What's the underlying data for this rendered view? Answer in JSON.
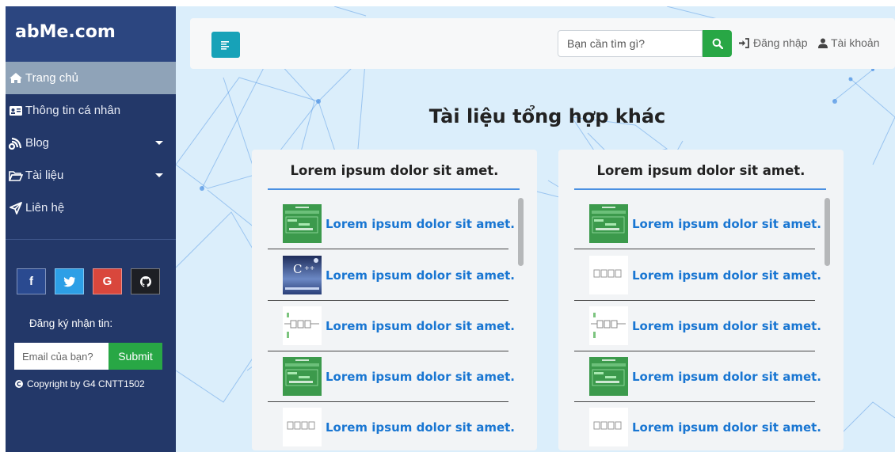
{
  "sidebar": {
    "brand": "abMe.com",
    "items": [
      {
        "label": "Trang chủ",
        "icon": "home-icon"
      },
      {
        "label": "Thông tin cá nhân",
        "icon": "id-card-icon"
      },
      {
        "label": "Blog",
        "icon": "blog-icon"
      },
      {
        "label": "Tài liệu",
        "icon": "folder-open-icon"
      },
      {
        "label": "Liên hệ",
        "icon": "paper-plane-icon"
      }
    ],
    "socials": [
      "f",
      "facebook-icon",
      "twitter-icon",
      "G",
      "github-icon"
    ],
    "google_letter": "G",
    "facebook_letter": "f",
    "newsletter_label": "Đăng ký nhận tin:",
    "email_placeholder": "Email của bạn?",
    "submit_label": "Submit",
    "copyright": "Copyright by G4 CNTT1502"
  },
  "topbar": {
    "search_placeholder": "Bạn cần tìm gì?",
    "login_label": "Đăng nhập",
    "account_label": "Tài khoản"
  },
  "main": {
    "heading": "Tài liệu tổng hợp khác",
    "cards": [
      {
        "title": "Lorem ipsum dolor sit amet.",
        "items": [
          {
            "text": "Lorem ipsum dolor sit amet.",
            "thumb": "green"
          },
          {
            "text": "Lorem ipsum dolor sit amet.",
            "thumb": "cpp"
          },
          {
            "text": "Lorem ipsum dolor sit amet.",
            "thumb": "diagram"
          },
          {
            "text": "Lorem ipsum dolor sit amet.",
            "thumb": "green"
          },
          {
            "text": "Lorem ipsum dolor sit amet.",
            "thumb": "diagram"
          }
        ]
      },
      {
        "title": "Lorem ipsum dolor sit amet.",
        "items": [
          {
            "text": "Lorem ipsum dolor sit amet.",
            "thumb": "green"
          },
          {
            "text": "Lorem ipsum dolor sit amet.",
            "thumb": "diagram"
          },
          {
            "text": "Lorem ipsum dolor sit amet.",
            "thumb": "diagram"
          },
          {
            "text": "Lorem ipsum dolor sit amet.",
            "thumb": "green"
          },
          {
            "text": "Lorem ipsum dolor sit amet.",
            "thumb": "diagram"
          }
        ]
      }
    ]
  },
  "colors": {
    "sidebar": "#233869",
    "brand_bg": "#2c4680",
    "active": "#8fa3b8",
    "accent_green": "#28a745",
    "toggle": "#17a2b8",
    "link_blue": "#1976d2",
    "rule_blue": "#4a90e2"
  }
}
